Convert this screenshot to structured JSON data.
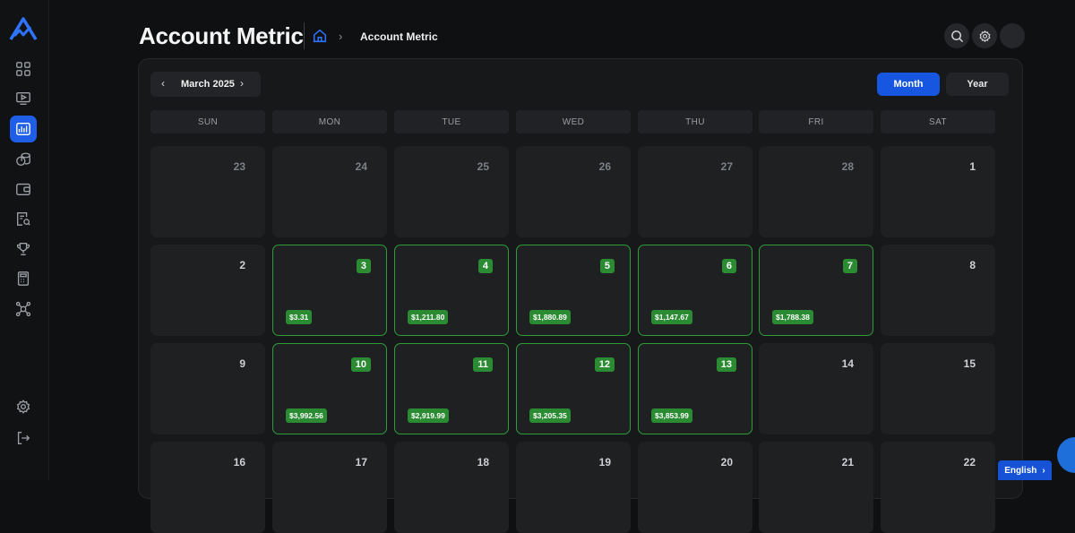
{
  "page": {
    "title": "Account Metric"
  },
  "breadcrumb": {
    "current": "Account Metric"
  },
  "sidebar": {
    "items": [
      {
        "icon": "dashboard-grid-icon"
      },
      {
        "icon": "video-player-icon"
      },
      {
        "icon": "calendar-metrics-icon",
        "active": true
      },
      {
        "icon": "coins-icon"
      },
      {
        "icon": "wallet-icon"
      },
      {
        "icon": "report-search-icon"
      },
      {
        "icon": "trophy-icon"
      },
      {
        "icon": "calculator-icon"
      },
      {
        "icon": "network-icon"
      }
    ],
    "bottom": [
      {
        "icon": "gear-icon"
      },
      {
        "icon": "logout-icon"
      }
    ]
  },
  "calendar": {
    "month_label": "March 2025",
    "prev_symbol": "‹",
    "next_symbol": "›",
    "views": {
      "month": "Month",
      "year": "Year"
    },
    "weekdays": [
      "SUN",
      "MON",
      "TUE",
      "WED",
      "THU",
      "FRI",
      "SAT"
    ],
    "weeks": [
      [
        {
          "day": "23",
          "faded": true
        },
        {
          "day": "24",
          "faded": true
        },
        {
          "day": "25",
          "faded": true
        },
        {
          "day": "26",
          "faded": true
        },
        {
          "day": "27",
          "faded": true
        },
        {
          "day": "28",
          "faded": true
        },
        {
          "day": "1"
        }
      ],
      [
        {
          "day": "2"
        },
        {
          "day": "3",
          "pnl": "$3.31"
        },
        {
          "day": "4",
          "pnl": "$1,211.80"
        },
        {
          "day": "5",
          "pnl": "$1,880.89"
        },
        {
          "day": "6",
          "pnl": "$1,147.67"
        },
        {
          "day": "7",
          "pnl": "$1,788.38"
        },
        {
          "day": "8"
        }
      ],
      [
        {
          "day": "9"
        },
        {
          "day": "10",
          "pnl": "$3,992.56"
        },
        {
          "day": "11",
          "pnl": "$2,919.99"
        },
        {
          "day": "12",
          "pnl": "$3,205.35"
        },
        {
          "day": "13",
          "pnl": "$3,853.99"
        },
        {
          "day": "14"
        },
        {
          "day": "15"
        }
      ],
      [
        {
          "day": "16"
        },
        {
          "day": "17"
        },
        {
          "day": "18"
        },
        {
          "day": "19"
        },
        {
          "day": "20"
        },
        {
          "day": "21"
        },
        {
          "day": "22"
        }
      ]
    ]
  },
  "language": {
    "label": "English",
    "chevron": "›"
  },
  "colors": {
    "accent": "#1656e0",
    "profit": "#2a8b33",
    "profit_border": "#2f9b3a"
  }
}
